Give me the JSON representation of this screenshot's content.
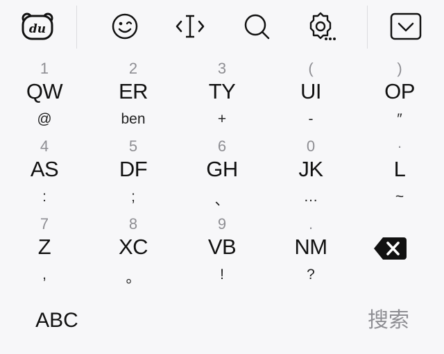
{
  "toolbar": {
    "icons": [
      "du-bear-logo-icon",
      "emoji-face-icon",
      "text-cursor-icon",
      "search-icon",
      "settings-more-icon",
      "collapse-chevron-down-icon"
    ]
  },
  "keys": {
    "row1": [
      {
        "top": "1",
        "main": "QW",
        "bottom": "@"
      },
      {
        "top": "2",
        "main": "ER",
        "bottom": "ben"
      },
      {
        "top": "3",
        "main": "TY",
        "bottom": "+"
      },
      {
        "top": "(",
        "main": "UI",
        "bottom": "-"
      },
      {
        "top": ")",
        "main": "OP",
        "bottom": "″"
      }
    ],
    "row2": [
      {
        "top": "4",
        "main": "AS",
        "bottom": ":"
      },
      {
        "top": "5",
        "main": "DF",
        "bottom": ";"
      },
      {
        "top": "6",
        "main": "GH",
        "bottom": "、"
      },
      {
        "top": "0",
        "main": "JK",
        "bottom": "…"
      },
      {
        "top": "·",
        "main": "L",
        "bottom": "~"
      }
    ],
    "row3": [
      {
        "top": "7",
        "main": "Z",
        "bottom": ","
      },
      {
        "top": "8",
        "main": "XC",
        "bottom": "。"
      },
      {
        "top": "9",
        "main": "VB",
        "bottom": "!"
      },
      {
        "top": ".",
        "main": "NM",
        "bottom": "?"
      }
    ]
  },
  "bottom_bar": {
    "abc_label": "ABC",
    "search_label": "搜索"
  }
}
